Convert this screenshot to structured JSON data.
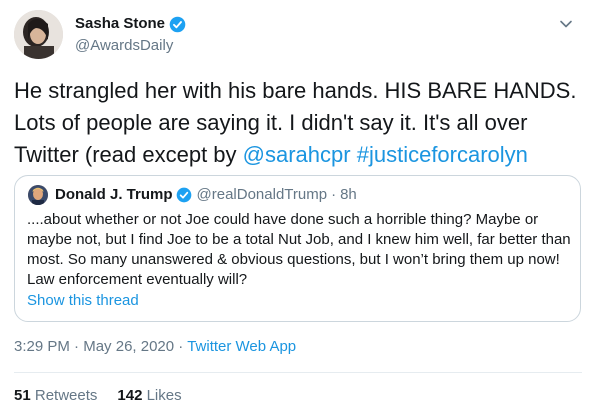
{
  "author": {
    "display_name": "Sasha Stone",
    "handle": "@AwardsDaily",
    "avatar_icon": "profile-photo",
    "verified_icon": "verified-badge-icon"
  },
  "tweet": {
    "text_part1": "He strangled her with his bare hands. HIS BARE HANDS. Lots of people are saying it. I didn't say it. It's all over Twitter (read except by ",
    "mention": "@sarahcpr",
    "text_part2": " ",
    "hashtag": "#justiceforcarolyn"
  },
  "quoted": {
    "display_name": "Donald J. Trump",
    "handle": "@realDonaldTrump",
    "separator": "·",
    "time": "8h",
    "text": "....about whether or not Joe could have done such a horrible thing? Maybe or maybe not, but I find Joe to be a total Nut Job, and I knew him well, far better than most. So many unanswered & obvious questions, but I won’t bring them up now! Law enforcement eventually will?",
    "show_thread": "Show this thread"
  },
  "meta": {
    "time": "3:29 PM",
    "sep1": " · ",
    "date": "May 26, 2020",
    "sep2": " · ",
    "source": "Twitter Web App"
  },
  "stats": {
    "retweets_count": "51",
    "retweets_label": " Retweets",
    "likes_count": "142",
    "likes_label": " Likes"
  },
  "colors": {
    "link": "#1b95e0",
    "secondary": "#657786",
    "border": "#ccd6dd"
  }
}
